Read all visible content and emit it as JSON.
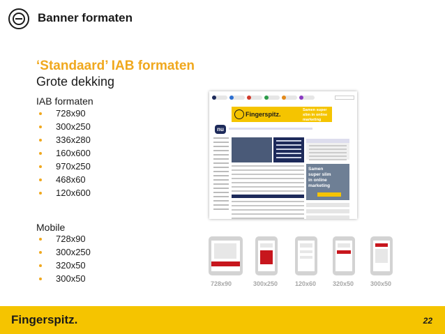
{
  "header": {
    "title": "Banner formaten"
  },
  "heading": "‘Standaard’ IAB formaten",
  "subheading": "Grote dekking",
  "iab": {
    "title": "IAB formaten",
    "items": [
      "728x90",
      "300x250",
      "336x280",
      "160x600",
      "970x250",
      "468x60",
      "120x600"
    ]
  },
  "mobile": {
    "title": "Mobile",
    "items": [
      "728x90",
      "300x250",
      "320x50",
      "300x50"
    ]
  },
  "website_mock": {
    "brand": "Fingerspitz.",
    "slogan": "Samen super slim in online marketing",
    "side_banner": "Samen super slim in online marketing",
    "logo": "nu"
  },
  "device_labels": [
    "728x90",
    "300x250",
    "120x60",
    "320x50",
    "300x50"
  ],
  "footer": {
    "brand": "Fingerspitz.",
    "page_number": "22"
  },
  "colors": {
    "accent": "#f0a81e",
    "footer": "#f5c400",
    "ad": "#c7161d",
    "device": "#d3d3d3"
  }
}
